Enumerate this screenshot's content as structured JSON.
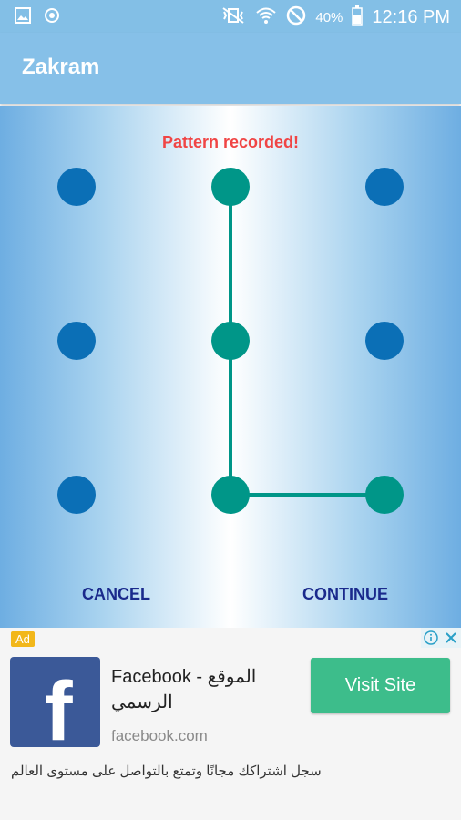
{
  "status_bar": {
    "battery_percent": "40%",
    "time": "12:16 PM",
    "left_icons": [
      "gallery-icon",
      "settings-notification-icon"
    ],
    "right_icons": [
      "vibrate-mute-icon",
      "wifi-icon",
      "do-not-disturb-icon",
      "battery-icon"
    ]
  },
  "app_bar": {
    "title": "Zakram"
  },
  "pattern": {
    "message": "Pattern recorded!",
    "colors": {
      "idle_dot": "#0b6fb6",
      "active_dot": "#009688",
      "line": "#009688",
      "message": "#f04545"
    },
    "dots": [
      {
        "row": 0,
        "col": 0,
        "selected": false
      },
      {
        "row": 0,
        "col": 1,
        "selected": true
      },
      {
        "row": 0,
        "col": 2,
        "selected": false
      },
      {
        "row": 1,
        "col": 0,
        "selected": false
      },
      {
        "row": 1,
        "col": 1,
        "selected": true
      },
      {
        "row": 1,
        "col": 2,
        "selected": false
      },
      {
        "row": 2,
        "col": 0,
        "selected": false
      },
      {
        "row": 2,
        "col": 1,
        "selected": true
      },
      {
        "row": 2,
        "col": 2,
        "selected": true
      }
    ],
    "path": [
      [
        0,
        1
      ],
      [
        1,
        1
      ],
      [
        2,
        1
      ],
      [
        2,
        2
      ]
    ]
  },
  "actions": {
    "cancel_label": "CANCEL",
    "continue_label": "CONTINUE"
  },
  "ad": {
    "badge": "Ad",
    "info_icon": "info-icon",
    "close_icon": "close-icon",
    "logo_letter": "f",
    "title": "Facebook - الموقع الرسمي",
    "domain": "facebook.com",
    "cta_label": "Visit Site",
    "description": "سجل اشتراكك مجانًا وتمتع بالتواصل على مستوى العالم",
    "colors": {
      "badge": "#f2b71a",
      "logo_bg": "#3b5998",
      "cta_bg": "#3dbd8b"
    }
  }
}
